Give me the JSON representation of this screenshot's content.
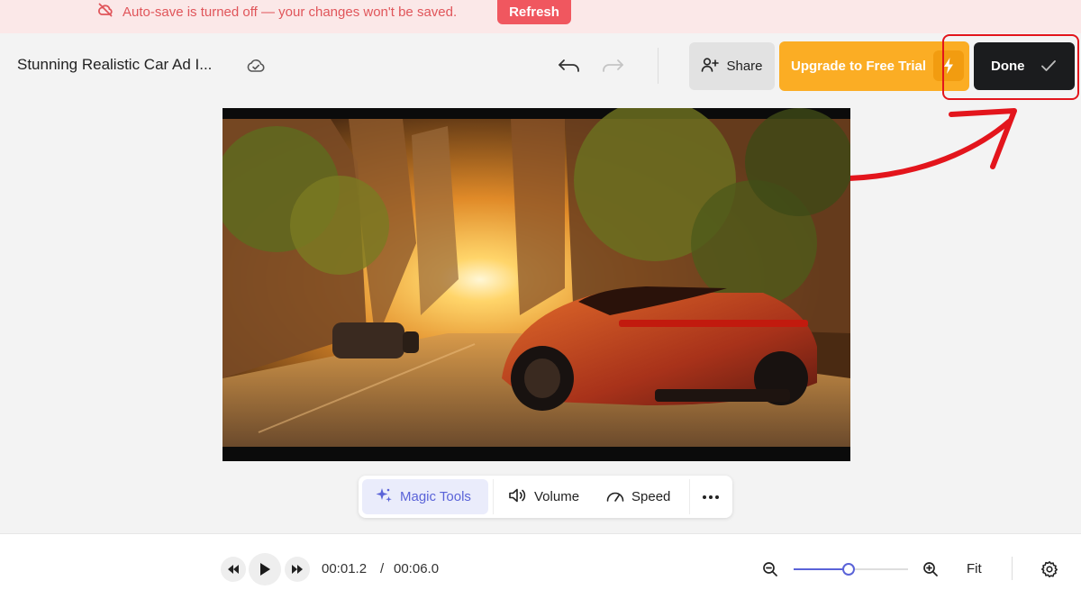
{
  "banner": {
    "message": "Auto-save is turned off — your changes won't be saved.",
    "refresh_label": "Refresh",
    "icon": "cloud-off-icon"
  },
  "header": {
    "project_title": "Stunning Realistic Car Ad I...",
    "share_label": "Share",
    "upgrade_label": "Upgrade to Free Trial",
    "done_label": "Done"
  },
  "video": {
    "description_icon": "video-preview"
  },
  "toolbar": {
    "magic_tools_label": "Magic Tools",
    "volume_label": "Volume",
    "speed_label": "Speed"
  },
  "player": {
    "current_time": "00:01.2",
    "separator": "/",
    "total_time": "00:06.0",
    "fit_label": "Fit",
    "zoom_level": 0.48
  },
  "colors": {
    "accent": "#5a63d8",
    "upgrade": "#fbad24",
    "done": "#1b1c1e",
    "warning": "#e0555a",
    "annotation": "#e3151c"
  }
}
